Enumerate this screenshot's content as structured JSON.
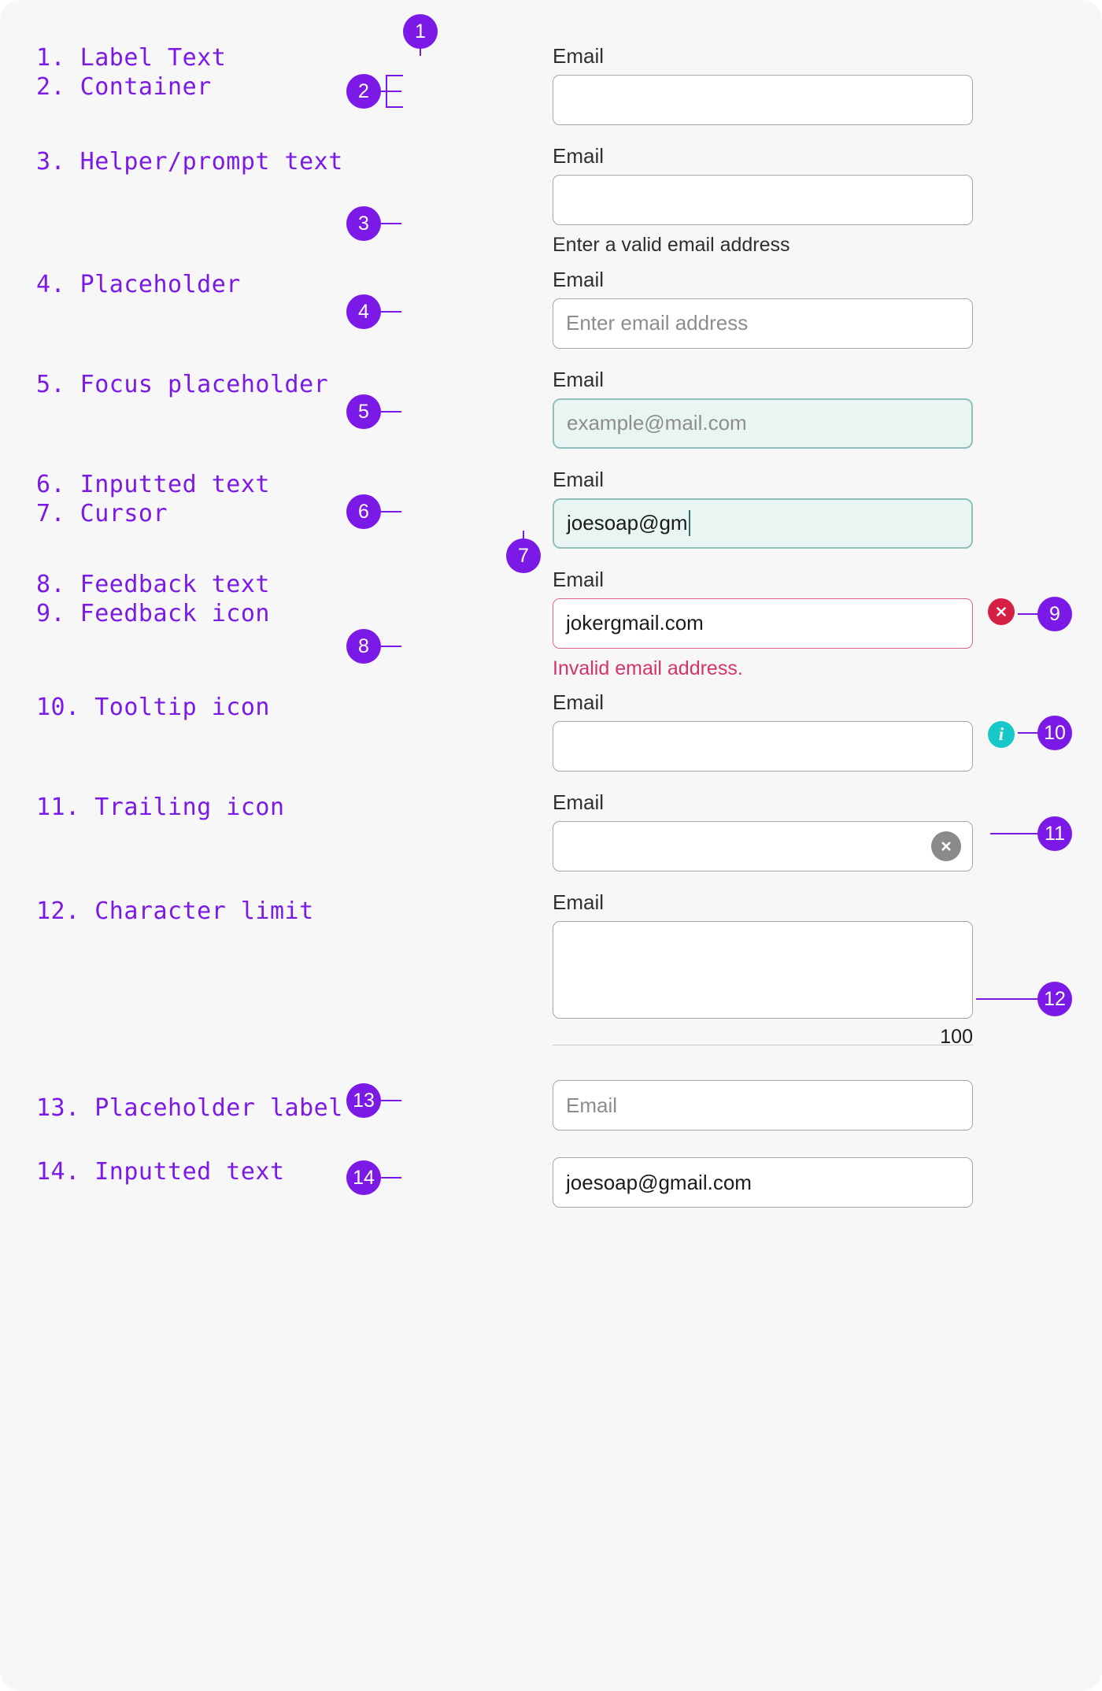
{
  "accent_color": "#7B19E6",
  "focus_border_color": "#8FC0BB",
  "focus_fill_color": "#E9F5F3",
  "error_color": "#D6336C",
  "error_icon_color": "#D61F45",
  "info_icon_color": "#18C8C8",
  "spec_list": [
    {
      "num": "1.",
      "label": "Label Text"
    },
    {
      "num": "2.",
      "label": "Container"
    },
    {
      "num": "3.",
      "label": "Helper/prompt text"
    },
    {
      "num": "4.",
      "label": "Placeholder"
    },
    {
      "num": "5.",
      "label": "Focus placeholder"
    },
    {
      "num": "6.",
      "label": "Inputted text"
    },
    {
      "num": "7.",
      "label": "Cursor"
    },
    {
      "num": "8.",
      "label": "Feedback text"
    },
    {
      "num": "9.",
      "label": "Feedback icon"
    },
    {
      "num": "10.",
      "label": "Tooltip icon"
    },
    {
      "num": "11.",
      "label": "Trailing icon"
    },
    {
      "num": "12.",
      "label": "Character limit"
    },
    {
      "num": "13.",
      "label": "Placeholder label"
    },
    {
      "num": "14.",
      "label": "Inputted text"
    }
  ],
  "spec_text": {
    "s1": "1. Label Text",
    "s2": "2. Container",
    "s3": "3. Helper/prompt text",
    "s4": "4. Placeholder",
    "s5": "5. Focus placeholder",
    "s6": "6. Inputted text",
    "s7": "7. Cursor",
    "s8": "8. Feedback text",
    "s9": "9. Feedback icon",
    "s10": "10. Tooltip icon",
    "s11": "11. Trailing icon",
    "s12": "12. Character limit",
    "s13": "13. Placeholder label",
    "s14": "14. Inputted text"
  },
  "callouts": {
    "c1": "1",
    "c2": "2",
    "c3": "3",
    "c4": "4",
    "c5": "5",
    "c6": "6",
    "c7": "7",
    "c8": "8",
    "c9": "9",
    "c10": "10",
    "c11": "11",
    "c12": "12",
    "c13": "13",
    "c14": "14"
  },
  "fields": {
    "f1": {
      "label": "Email",
      "value": ""
    },
    "f2": {
      "label": "Email",
      "value": "",
      "helper": "Enter a valid email address"
    },
    "f3": {
      "label": "Email",
      "placeholder": "Enter email address"
    },
    "f4": {
      "label": "Email",
      "placeholder": "example@mail.com",
      "state": "focus"
    },
    "f5": {
      "label": "Email",
      "value": "joesoap@gm",
      "state": "focus"
    },
    "f6": {
      "label": "Email",
      "value": "jokergmail.com",
      "helper": "Invalid email address.",
      "state": "error"
    },
    "f7": {
      "label": "Email",
      "value": ""
    },
    "f8": {
      "label": "Email",
      "value": ""
    },
    "f9": {
      "label": "Email",
      "value": "",
      "counter": "100"
    },
    "f10": {
      "placeholder": "Email"
    },
    "f11": {
      "value": "joesoap@gmail.com"
    }
  },
  "icons": {
    "error": "error-circle-icon",
    "info": "i",
    "clear": "clear-circle-icon"
  }
}
